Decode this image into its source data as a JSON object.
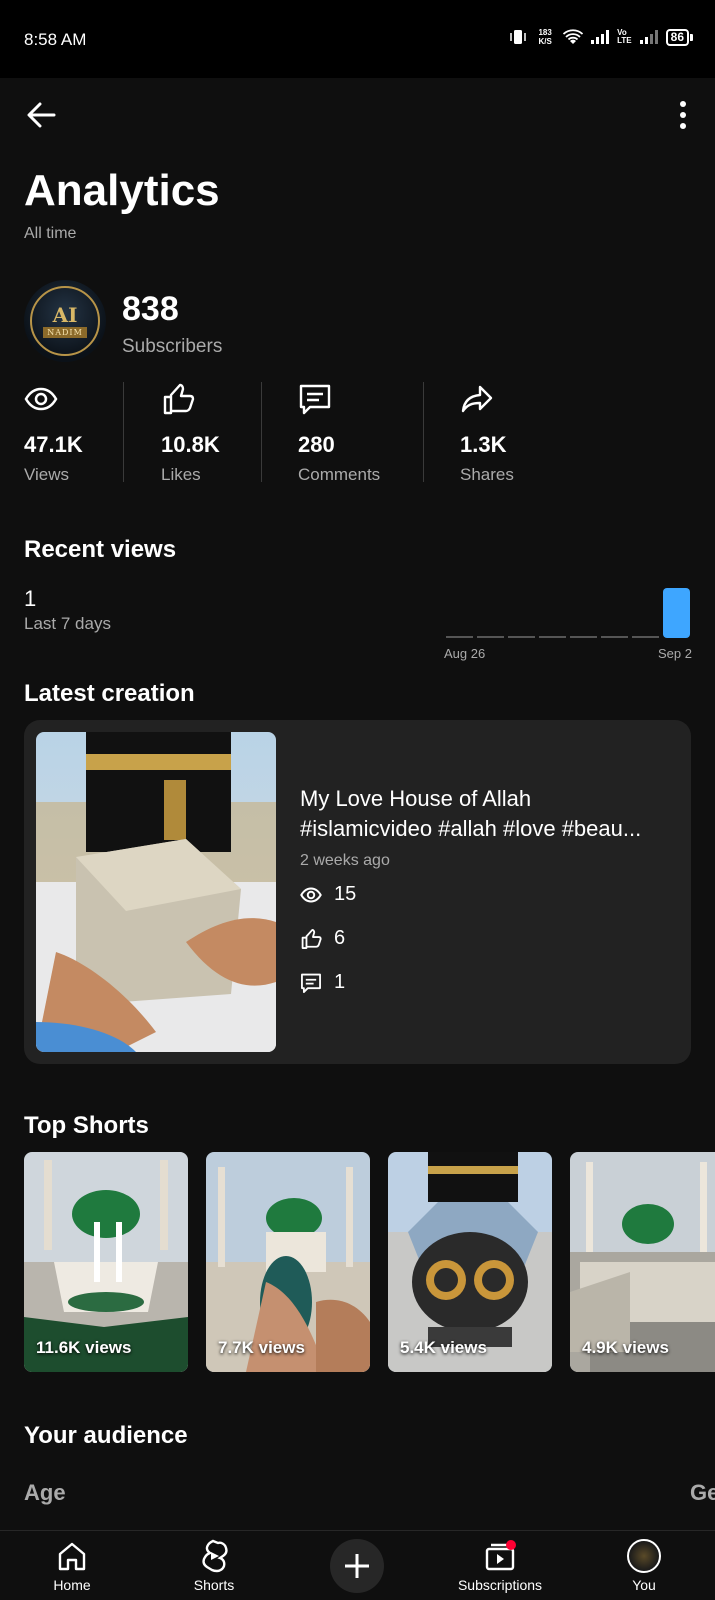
{
  "status_bar": {
    "time": "8:58 AM",
    "net_speed": "183 K/S",
    "battery": "86"
  },
  "page": {
    "title": "Analytics",
    "period": "All time"
  },
  "channel": {
    "avatar_text": "AI",
    "avatar_subtext": "NADIM",
    "subscriber_count": "838",
    "subscriber_label": "Subscribers"
  },
  "stats": [
    {
      "icon": "eye-icon",
      "value": "47.1K",
      "label": "Views"
    },
    {
      "icon": "thumbs-up-icon",
      "value": "10.8K",
      "label": "Likes"
    },
    {
      "icon": "comment-icon",
      "value": "280",
      "label": "Comments"
    },
    {
      "icon": "share-icon",
      "value": "1.3K",
      "label": "Shares"
    }
  ],
  "recent_views": {
    "heading": "Recent views",
    "value": "1",
    "label": "Last 7 days",
    "chart_data": {
      "type": "bar",
      "x_start_label": "Aug 26",
      "x_end_label": "Sep 2",
      "values": [
        0,
        0,
        0,
        0,
        0,
        0,
        0,
        1
      ],
      "color": "#3ea6ff"
    }
  },
  "latest": {
    "heading": "Latest creation",
    "title_line1": "My Love House of Allah",
    "title_line2": "#islamicvideo #allah #love #beau...",
    "age": "2 weeks ago",
    "views": "15",
    "likes": "6",
    "comments": "1"
  },
  "top_shorts": {
    "heading": "Top Shorts",
    "items": [
      {
        "views": "11.6K views"
      },
      {
        "views": "7.7K views"
      },
      {
        "views": "5.4K views"
      },
      {
        "views": "4.9K views"
      }
    ]
  },
  "audience": {
    "heading": "Your audience",
    "tab_age": "Age",
    "tab_gender": "Ge"
  },
  "nav": {
    "home": "Home",
    "shorts": "Shorts",
    "subscriptions": "Subscriptions",
    "you": "You"
  },
  "colors": {
    "accent": "#3ea6ff",
    "notification": "#ff0033",
    "card": "#222222"
  }
}
